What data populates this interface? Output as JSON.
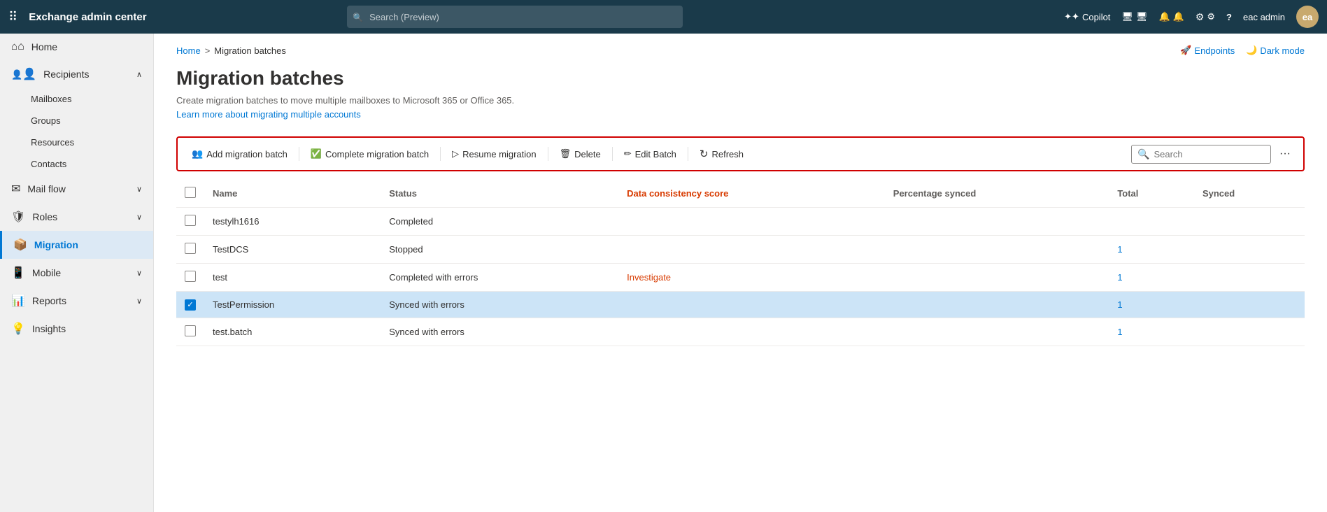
{
  "topbar": {
    "app_title": "Exchange admin center",
    "search_placeholder": "Search (Preview)",
    "copilot_label": "Copilot",
    "user_label": "eac admin",
    "user_initials": "ea"
  },
  "header_actions": {
    "endpoints_label": "Endpoints",
    "dark_mode_label": "Dark mode"
  },
  "breadcrumb": {
    "home": "Home",
    "separator": ">",
    "current": "Migration batches"
  },
  "page": {
    "title": "Migration batches",
    "description": "Create migration batches to move multiple mailboxes to Microsoft 365 or Office 365.",
    "learn_more_link": "Learn more about migrating multiple accounts"
  },
  "toolbar": {
    "add_migration_batch": "Add migration batch",
    "complete_migration_batch": "Complete migration batch",
    "resume_migration": "Resume migration",
    "delete": "Delete",
    "edit_batch": "Edit Batch",
    "refresh": "Refresh",
    "search_placeholder": "Search"
  },
  "table": {
    "columns": {
      "name": "Name",
      "status": "Status",
      "data_consistency_score": "Data consistency score",
      "percentage_synced": "Percentage synced",
      "total": "Total",
      "synced": "Synced"
    },
    "rows": [
      {
        "id": 1,
        "checked": false,
        "name": "testylh1616",
        "status": "Completed",
        "status_class": "status-completed",
        "data_consistency_score": "",
        "percentage_synced": "",
        "total": "",
        "synced": ""
      },
      {
        "id": 2,
        "checked": false,
        "name": "TestDCS",
        "status": "Stopped",
        "status_class": "status-stopped",
        "data_consistency_score": "",
        "percentage_synced": "",
        "total": "1",
        "synced": ""
      },
      {
        "id": 3,
        "checked": false,
        "name": "test",
        "status": "Completed with errors",
        "status_class": "status-errors",
        "data_consistency_score": "Investigate",
        "percentage_synced": "",
        "total": "1",
        "synced": ""
      },
      {
        "id": 4,
        "checked": true,
        "name": "TestPermission",
        "status": "Synced with errors",
        "status_class": "status-synced-errors",
        "data_consistency_score": "",
        "percentage_synced": "",
        "total": "1",
        "synced": ""
      },
      {
        "id": 5,
        "checked": false,
        "name": "test.batch",
        "status": "Synced with errors",
        "status_class": "status-synced-errors",
        "data_consistency_score": "",
        "percentage_synced": "",
        "total": "1",
        "synced": ""
      }
    ]
  },
  "sidebar": {
    "items": [
      {
        "id": "home",
        "label": "Home",
        "icon": "icon-home",
        "has_children": false,
        "active": false
      },
      {
        "id": "recipients",
        "label": "Recipients",
        "icon": "icon-people",
        "has_children": true,
        "active": false,
        "expanded": true
      },
      {
        "id": "mailboxes",
        "label": "Mailboxes",
        "icon": "",
        "has_children": false,
        "active": false,
        "sub": true
      },
      {
        "id": "groups",
        "label": "Groups",
        "icon": "",
        "has_children": false,
        "active": false,
        "sub": true
      },
      {
        "id": "resources",
        "label": "Resources",
        "icon": "",
        "has_children": false,
        "active": false,
        "sub": true
      },
      {
        "id": "contacts",
        "label": "Contacts",
        "icon": "",
        "has_children": false,
        "active": false,
        "sub": true
      },
      {
        "id": "mail-flow",
        "label": "Mail flow",
        "icon": "icon-mail",
        "has_children": true,
        "active": false
      },
      {
        "id": "roles",
        "label": "Roles",
        "icon": "icon-roles",
        "has_children": true,
        "active": false
      },
      {
        "id": "migration",
        "label": "Migration",
        "icon": "icon-migration",
        "has_children": false,
        "active": true
      },
      {
        "id": "mobile",
        "label": "Mobile",
        "icon": "icon-mobile",
        "has_children": true,
        "active": false
      },
      {
        "id": "reports",
        "label": "Reports",
        "icon": "icon-reports",
        "has_children": true,
        "active": false
      },
      {
        "id": "insights",
        "label": "Insights",
        "icon": "icon-insights",
        "has_children": false,
        "active": false
      }
    ]
  }
}
